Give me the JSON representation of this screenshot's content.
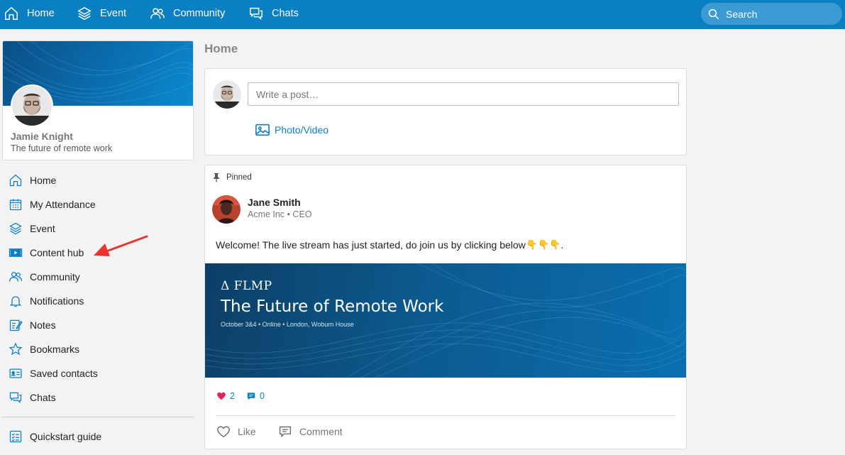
{
  "topnav": {
    "items": [
      {
        "label": "Home",
        "icon": "home-icon"
      },
      {
        "label": "Event",
        "icon": "layers-icon"
      },
      {
        "label": "Community",
        "icon": "people-icon"
      },
      {
        "label": "Chats",
        "icon": "chat-icon"
      }
    ],
    "search_label": "Search"
  },
  "profile": {
    "name": "Jamie Knight",
    "tagline": "The future of remote work"
  },
  "sidebar": {
    "items": [
      {
        "label": "Home",
        "icon": "home-icon"
      },
      {
        "label": "My Attendance",
        "icon": "calendar-icon"
      },
      {
        "label": "Event",
        "icon": "layers-icon"
      },
      {
        "label": "Content hub",
        "icon": "video-icon"
      },
      {
        "label": "Community",
        "icon": "people-icon"
      },
      {
        "label": "Notifications",
        "icon": "bell-icon"
      },
      {
        "label": "Notes",
        "icon": "notes-icon"
      },
      {
        "label": "Bookmarks",
        "icon": "star-icon"
      },
      {
        "label": "Saved contacts",
        "icon": "contact-card-icon"
      },
      {
        "label": "Chats",
        "icon": "chat-icon"
      }
    ],
    "footer_item": {
      "label": "Quickstart guide",
      "icon": "checklist-icon"
    }
  },
  "main": {
    "title": "Home",
    "composer": {
      "placeholder": "Write a post…",
      "photo_label": "Photo/Video"
    },
    "post": {
      "pinned_label": "Pinned",
      "author": "Jane Smith",
      "author_sub": "Acme Inc • CEO",
      "text": "Welcome! The live stream has just started, do join us by clicking below",
      "text_emoji": "👇👇👇",
      "text_end": ".",
      "image": {
        "logo": "Δ FLMP",
        "title": "The Future of Remote Work",
        "subtitle": "October 3&4 • Online • London, Woburn House"
      },
      "likes_count": "2",
      "comments_count": "0",
      "like_label": "Like",
      "comment_label": "Comment"
    }
  },
  "colors": {
    "brand_blue": "#0a7fc2",
    "heart_red": "#e0245e",
    "annotation_red": "#e8342b"
  }
}
